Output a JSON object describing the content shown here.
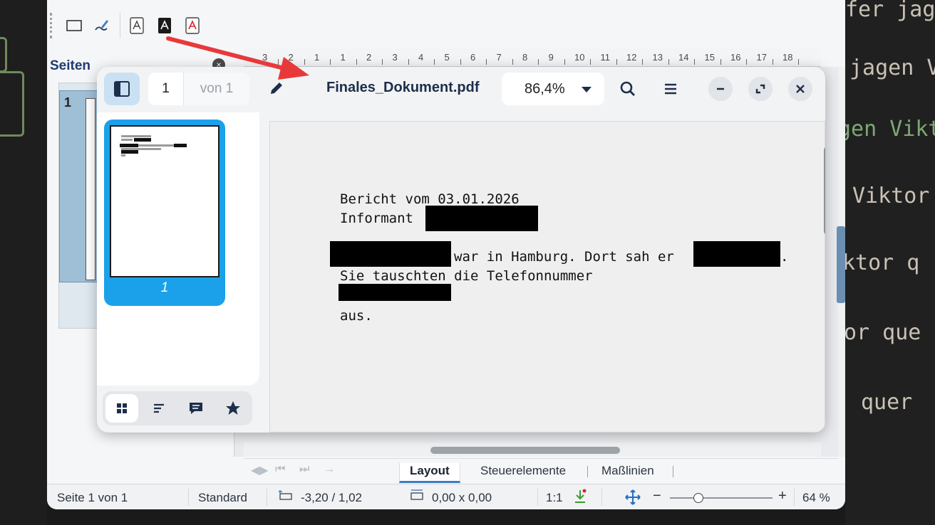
{
  "toolbar": {
    "icons": [
      "rectangle-icon",
      "signature-pen-icon",
      "pdf-export-icon",
      "pdf-export-direct-icon",
      "pdf-red-icon"
    ]
  },
  "side_panel": {
    "title": "Seiten",
    "close_glyph": "×",
    "page_number": "1"
  },
  "ruler": {
    "labels": [
      "3",
      "2",
      "1",
      "1",
      "2",
      "3",
      "4",
      "5",
      "6",
      "7",
      "8",
      "9",
      "10",
      "11",
      "12",
      "13",
      "14",
      "15",
      "16",
      "17",
      "18"
    ]
  },
  "viewer": {
    "page_current": "1",
    "page_total": "von 1",
    "filename": "Finales_Dokument.pdf",
    "zoom": "86,4%",
    "thumb_label": "1",
    "document": {
      "line1": "Bericht vom 03.01.2026",
      "line2": "Informant",
      "line3": "war in Hamburg. Dort sah er",
      "line3_end": ".",
      "line4": "Sie tauschten die Telefonnummer",
      "line5": "aus."
    }
  },
  "bottom_tabs": {
    "layout": "Layout",
    "steuerelemente": "Steuerelemente",
    "masslinien": "Maßlinien"
  },
  "status": {
    "page": "Seite 1 von 1",
    "style": "Standard",
    "position": "-3,20 / 1,02",
    "size": "0,00 x 0,00",
    "scale": "1:1",
    "zoom": "64 %",
    "zoom_level": 0.28
  },
  "background_terminal": {
    "lines": [
      "fer jage",
      "jagen V",
      "gen Vikt",
      "Viktor",
      "ktor q",
      "or que",
      "quer"
    ]
  },
  "colors": {
    "accent_blue": "#1ba1ea",
    "arrow_red": "#e8393a",
    "title_navy": "#1c2e4a"
  }
}
